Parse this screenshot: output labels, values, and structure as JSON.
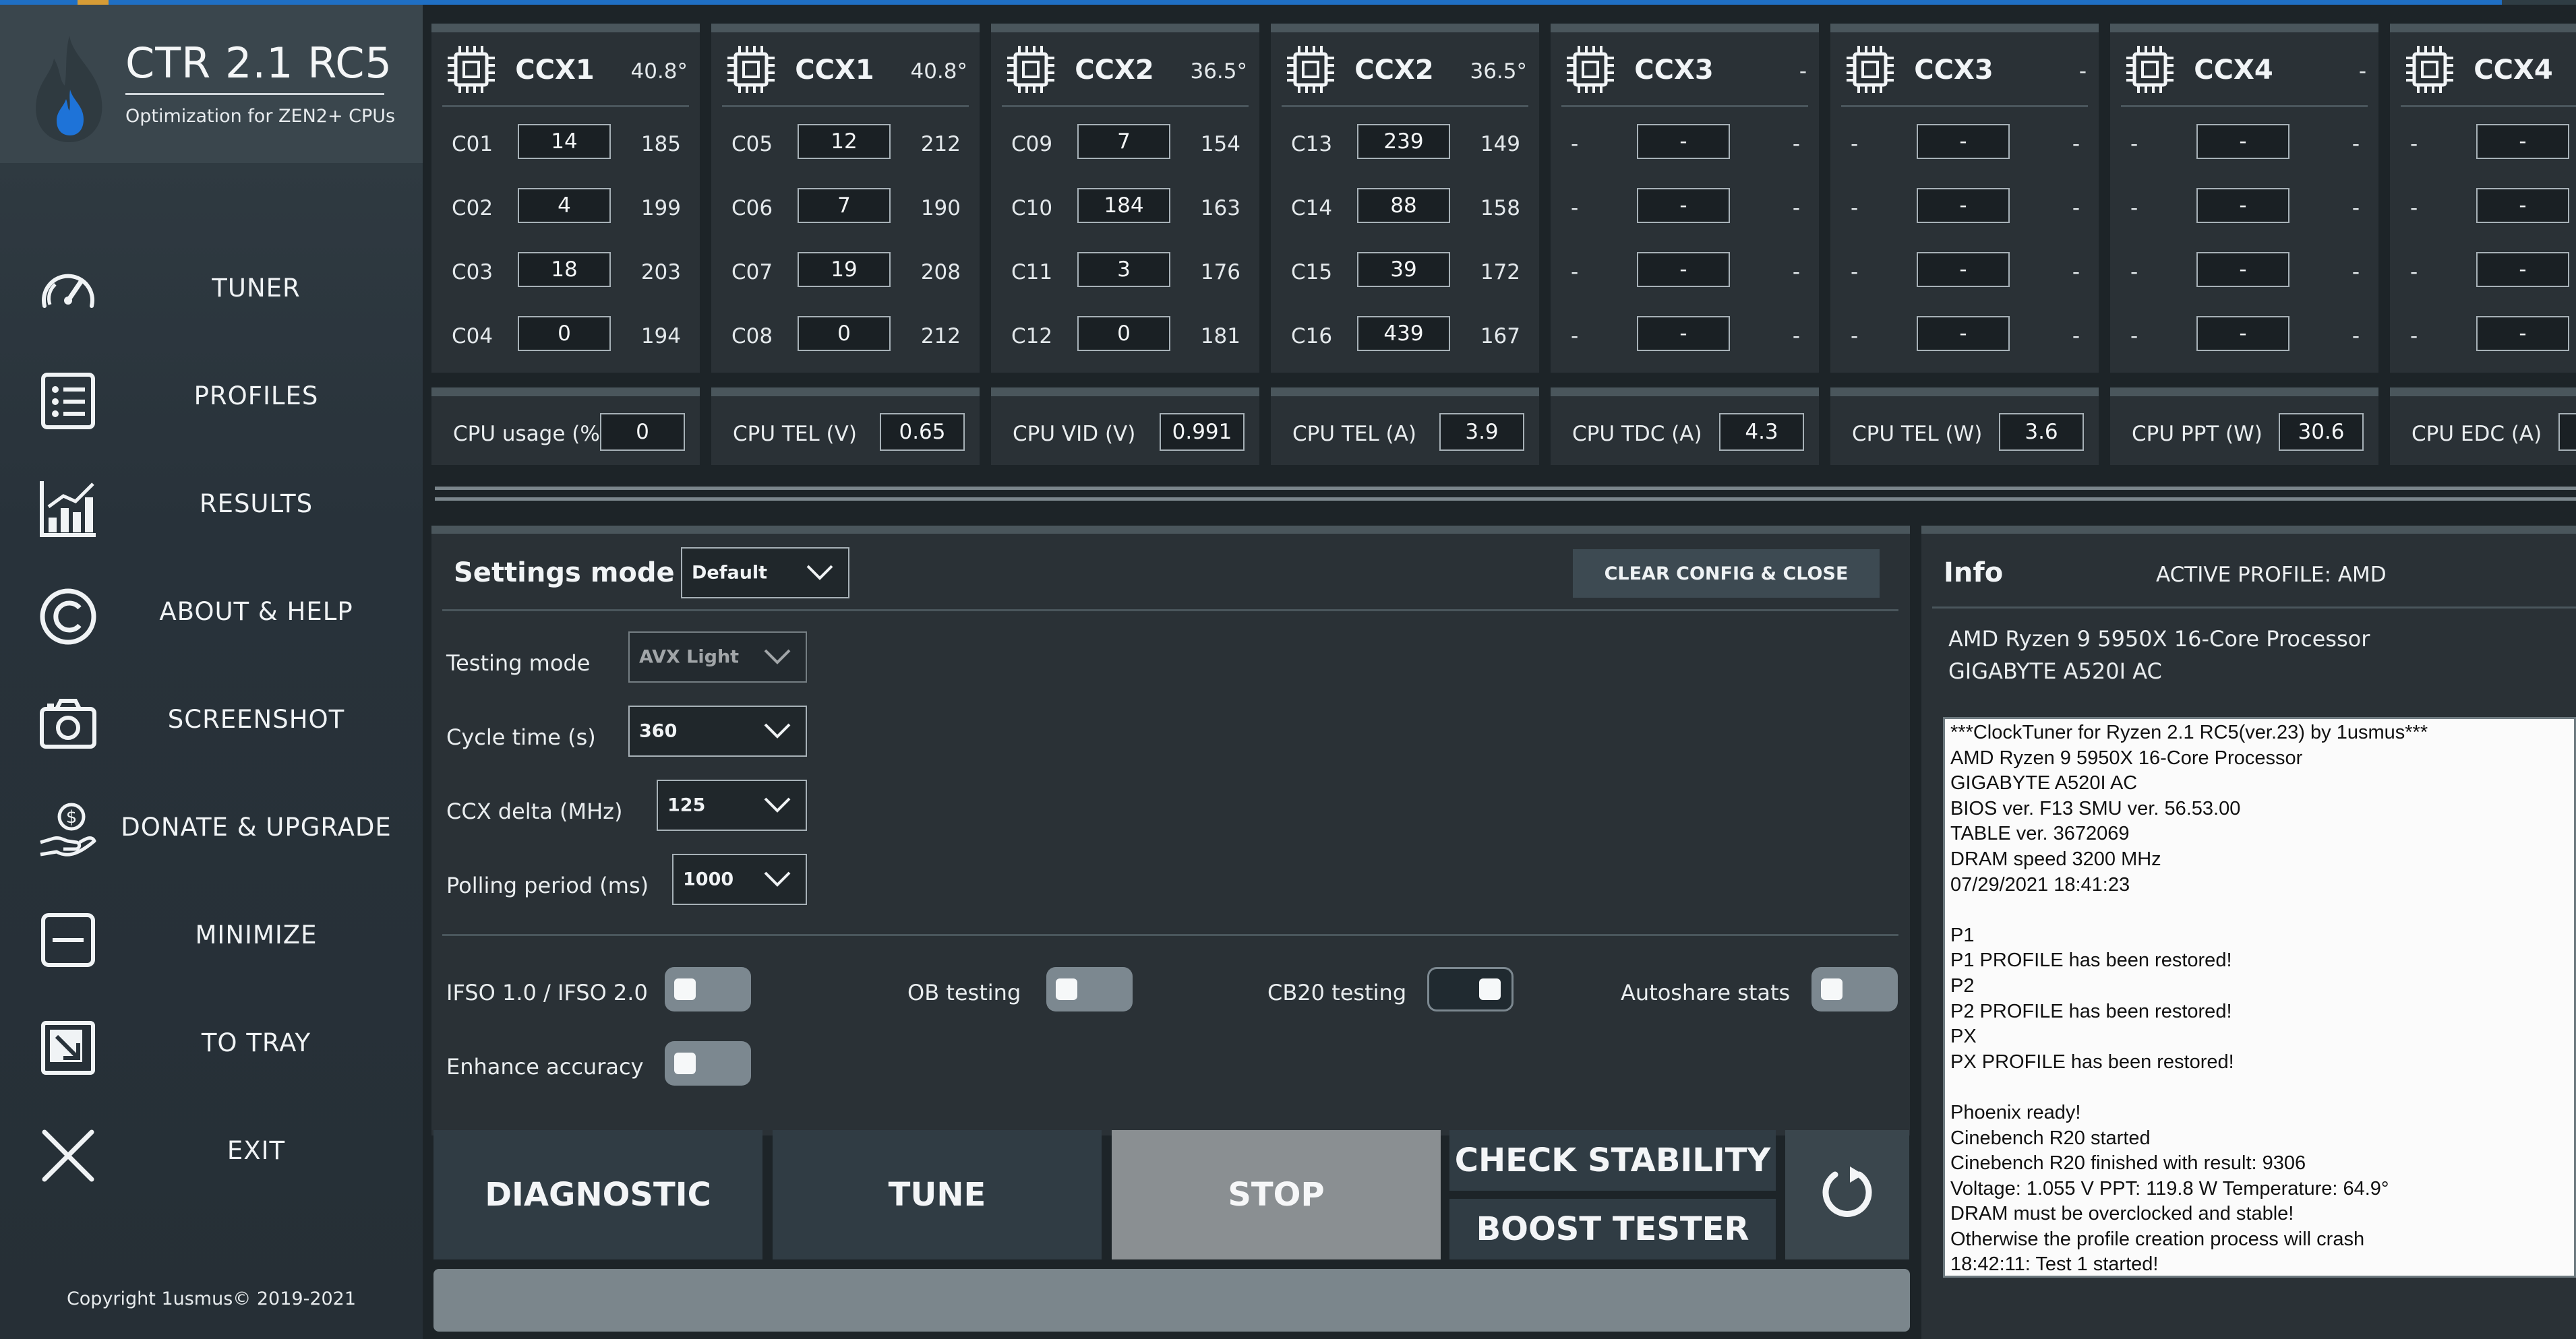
{
  "app": {
    "title": "CTR 2.1 RC5",
    "subtitle": "Optimization for ZEN2+ CPUs",
    "copyright": "Copyright 1usmus© 2019-2021"
  },
  "nav": [
    {
      "label": "TUNER",
      "icon": "speedometer-icon"
    },
    {
      "label": "PROFILES",
      "icon": "list-icon"
    },
    {
      "label": "RESULTS",
      "icon": "bar-chart-icon"
    },
    {
      "label": "ABOUT & HELP",
      "icon": "copyright-icon"
    },
    {
      "label": "SCREENSHOT",
      "icon": "camera-icon"
    },
    {
      "label": "DONATE & UPGRADE",
      "icon": "donate-hand-icon"
    },
    {
      "label": "MINIMIZE",
      "icon": "minimize-icon"
    },
    {
      "label": "TO TRAY",
      "icon": "tray-icon"
    },
    {
      "label": "EXIT",
      "icon": "close-icon"
    }
  ],
  "ccx": [
    {
      "name": "CCX1",
      "temp": "40.8°",
      "cores": [
        {
          "id": "C01",
          "value": "14",
          "freq": "185"
        },
        {
          "id": "C02",
          "value": "4",
          "freq": "199"
        },
        {
          "id": "C03",
          "value": "18",
          "freq": "203"
        },
        {
          "id": "C04",
          "value": "0",
          "freq": "194"
        }
      ]
    },
    {
      "name": "CCX1",
      "temp": "40.8°",
      "cores": [
        {
          "id": "C05",
          "value": "12",
          "freq": "212"
        },
        {
          "id": "C06",
          "value": "7",
          "freq": "190"
        },
        {
          "id": "C07",
          "value": "19",
          "freq": "208"
        },
        {
          "id": "C08",
          "value": "0",
          "freq": "212"
        }
      ]
    },
    {
      "name": "CCX2",
      "temp": "36.5°",
      "cores": [
        {
          "id": "C09",
          "value": "7",
          "freq": "154"
        },
        {
          "id": "C10",
          "value": "184",
          "freq": "163"
        },
        {
          "id": "C11",
          "value": "3",
          "freq": "176"
        },
        {
          "id": "C12",
          "value": "0",
          "freq": "181"
        }
      ]
    },
    {
      "name": "CCX2",
      "temp": "36.5°",
      "cores": [
        {
          "id": "C13",
          "value": "239",
          "freq": "149"
        },
        {
          "id": "C14",
          "value": "88",
          "freq": "158"
        },
        {
          "id": "C15",
          "value": "39",
          "freq": "172"
        },
        {
          "id": "C16",
          "value": "439",
          "freq": "167"
        }
      ]
    },
    {
      "name": "CCX3",
      "temp": "-",
      "cores": [
        {
          "id": "-",
          "value": "-",
          "freq": "-"
        },
        {
          "id": "-",
          "value": "-",
          "freq": "-"
        },
        {
          "id": "-",
          "value": "-",
          "freq": "-"
        },
        {
          "id": "-",
          "value": "-",
          "freq": "-"
        }
      ]
    },
    {
      "name": "CCX3",
      "temp": "-",
      "cores": [
        {
          "id": "-",
          "value": "-",
          "freq": "-"
        },
        {
          "id": "-",
          "value": "-",
          "freq": "-"
        },
        {
          "id": "-",
          "value": "-",
          "freq": "-"
        },
        {
          "id": "-",
          "value": "-",
          "freq": "-"
        }
      ]
    },
    {
      "name": "CCX4",
      "temp": "-",
      "cores": [
        {
          "id": "-",
          "value": "-",
          "freq": "-"
        },
        {
          "id": "-",
          "value": "-",
          "freq": "-"
        },
        {
          "id": "-",
          "value": "-",
          "freq": "-"
        },
        {
          "id": "-",
          "value": "-",
          "freq": "-"
        }
      ]
    },
    {
      "name": "CCX4",
      "temp": "",
      "cores": [
        {
          "id": "-",
          "value": "-",
          "freq": ""
        },
        {
          "id": "-",
          "value": "-",
          "freq": ""
        },
        {
          "id": "-",
          "value": "-",
          "freq": ""
        },
        {
          "id": "-",
          "value": "-",
          "freq": ""
        }
      ]
    }
  ],
  "metrics": [
    {
      "label": "CPU usage (%)",
      "value": "0"
    },
    {
      "label": "CPU TEL (V)",
      "value": "0.65"
    },
    {
      "label": "CPU VID (V)",
      "value": "0.991"
    },
    {
      "label": "CPU TEL (A)",
      "value": "3.9"
    },
    {
      "label": "CPU TDC (A)",
      "value": "4.3"
    },
    {
      "label": "CPU TEL (W)",
      "value": "3.6"
    },
    {
      "label": "CPU PPT (W)",
      "value": "30.6"
    },
    {
      "label": "CPU EDC (A)",
      "value": ""
    }
  ],
  "settings": {
    "title": "Settings mode",
    "mode_value": "Default",
    "clear_label": "CLEAR CONFIG & CLOSE",
    "testing_mode": {
      "label": "Testing mode",
      "value": "AVX Light"
    },
    "cycle_time": {
      "label": "Cycle time (s)",
      "value": "360"
    },
    "ccx_delta": {
      "label": "CCX delta (MHz)",
      "value": "125"
    },
    "polling": {
      "label": "Polling period (ms)",
      "value": "1000"
    },
    "toggles": [
      {
        "label": "IFSO 1.0 / IFSO 2.0",
        "state": "off"
      },
      {
        "label": "OB testing",
        "state": "off"
      },
      {
        "label": "CB20 testing",
        "state": "on"
      },
      {
        "label": "Autoshare stats",
        "state": "off"
      },
      {
        "label": "Enhance accuracy",
        "state": "off"
      }
    ]
  },
  "actions": {
    "diagnostic": "DIAGNOSTIC",
    "tune": "TUNE",
    "stop": "STOP",
    "check_stability": "CHECK STABILITY",
    "boost_tester": "BOOST TESTER",
    "refresh_icon": "refresh-icon",
    "progress": 0
  },
  "info": {
    "title": "Info",
    "active_profile": "ACTIVE PROFILE: AMD",
    "cpu": "AMD Ryzen 9 5950X 16-Core Processor",
    "board": "GIGABYTE A520I AC",
    "log": [
      "***ClockTuner for Ryzen 2.1 RC5(ver.23) by 1usmus***",
      "AMD Ryzen 9 5950X 16-Core Processor",
      "GIGABYTE A520I AC",
      "BIOS ver. F13 SMU ver. 56.53.00",
      "TABLE ver. 3672069",
      "DRAM speed 3200 MHz",
      "07/29/2021 18:41:23",
      "",
      "P1",
      "P1 PROFILE has been restored!",
      "P2",
      "P2 PROFILE has been restored!",
      "PX",
      "PX PROFILE has been restored!",
      "",
      "Phoenix ready!",
      "Cinebench R20 started",
      "Cinebench R20 finished with result: 9306",
      "Voltage: 1.055 V  PPT: 119.8 W  Temperature: 64.9°",
      "DRAM must be overclocked and stable!",
      "Otherwise the profile creation process will crash",
      "18:42:11: Test 1 started!"
    ]
  },
  "colors": {
    "accent_blue": "#1f6fc4",
    "panel": "#2a3136",
    "panel_top": "#4a565c",
    "sidebar": "#2d383f",
    "flame": "#1e73d8"
  }
}
